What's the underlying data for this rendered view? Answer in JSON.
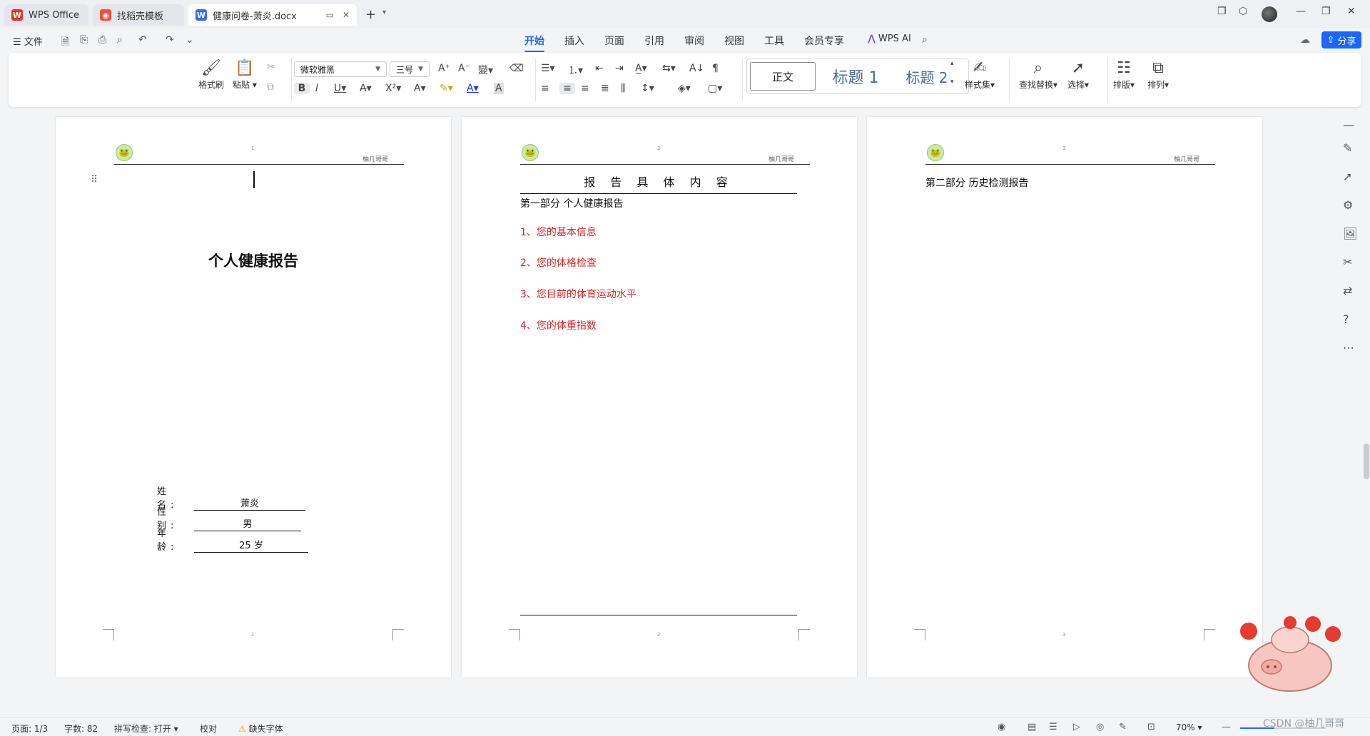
{
  "tabs": [
    {
      "label": "WPS Office",
      "icon": "wps-logo-icon"
    },
    {
      "label": "找稻壳模板",
      "icon": "docer-logo-icon"
    },
    {
      "label": "健康问卷-萧炎.docx",
      "icon": "word-doc-icon"
    }
  ],
  "menu": {
    "file": "文件",
    "tabs": [
      "开始",
      "插入",
      "页面",
      "引用",
      "审阅",
      "视图",
      "工具",
      "会员专享"
    ],
    "active_tab": "开始",
    "wps_ai": "WPS AI",
    "share": "分享"
  },
  "ribbon": {
    "format_painter": "格式刷",
    "paste": "粘贴",
    "font_name": "微软雅黑",
    "font_size": "三号",
    "styles": {
      "normal": "正文",
      "h1": "标题 1",
      "h2": "标题 2"
    },
    "style_set": "样式集",
    "find_replace": "查找替换",
    "select": "选择",
    "layout": "排版",
    "arrange": "排列"
  },
  "page1": {
    "header_page": "1",
    "header_right": "柚几哥哥",
    "title": "个人健康报告",
    "fields": [
      {
        "label": "姓  名:",
        "value": "萧炎"
      },
      {
        "label": "性  别:",
        "value": "男"
      },
      {
        "label": "年  龄:",
        "value": "25 岁"
      }
    ],
    "footer_page": "1"
  },
  "page2": {
    "header_page": "2",
    "header_right": "柚几哥哥",
    "title": "报 告 具 体 内 容",
    "section": "第一部分  个人健康报告",
    "items": [
      "1、您的基本信息",
      "2、您的体格检查",
      "3、您目前的体育运动水平",
      "4、您的体重指数"
    ],
    "footer_page": "2"
  },
  "page3": {
    "header_page": "3",
    "header_right": "柚几哥哥",
    "section": "第二部分  历史检测报告",
    "footer_page": "3"
  },
  "status": {
    "page": "页面: 1/3",
    "words": "字数: 82",
    "spell": "拼写检查: 打开",
    "proof": "校对",
    "missing_font": "缺失字体",
    "zoom": "70%"
  },
  "watermark": "CSDN @柚几哥哥",
  "colors": {
    "accent": "#1a66ff",
    "red_text": "#e52222"
  }
}
